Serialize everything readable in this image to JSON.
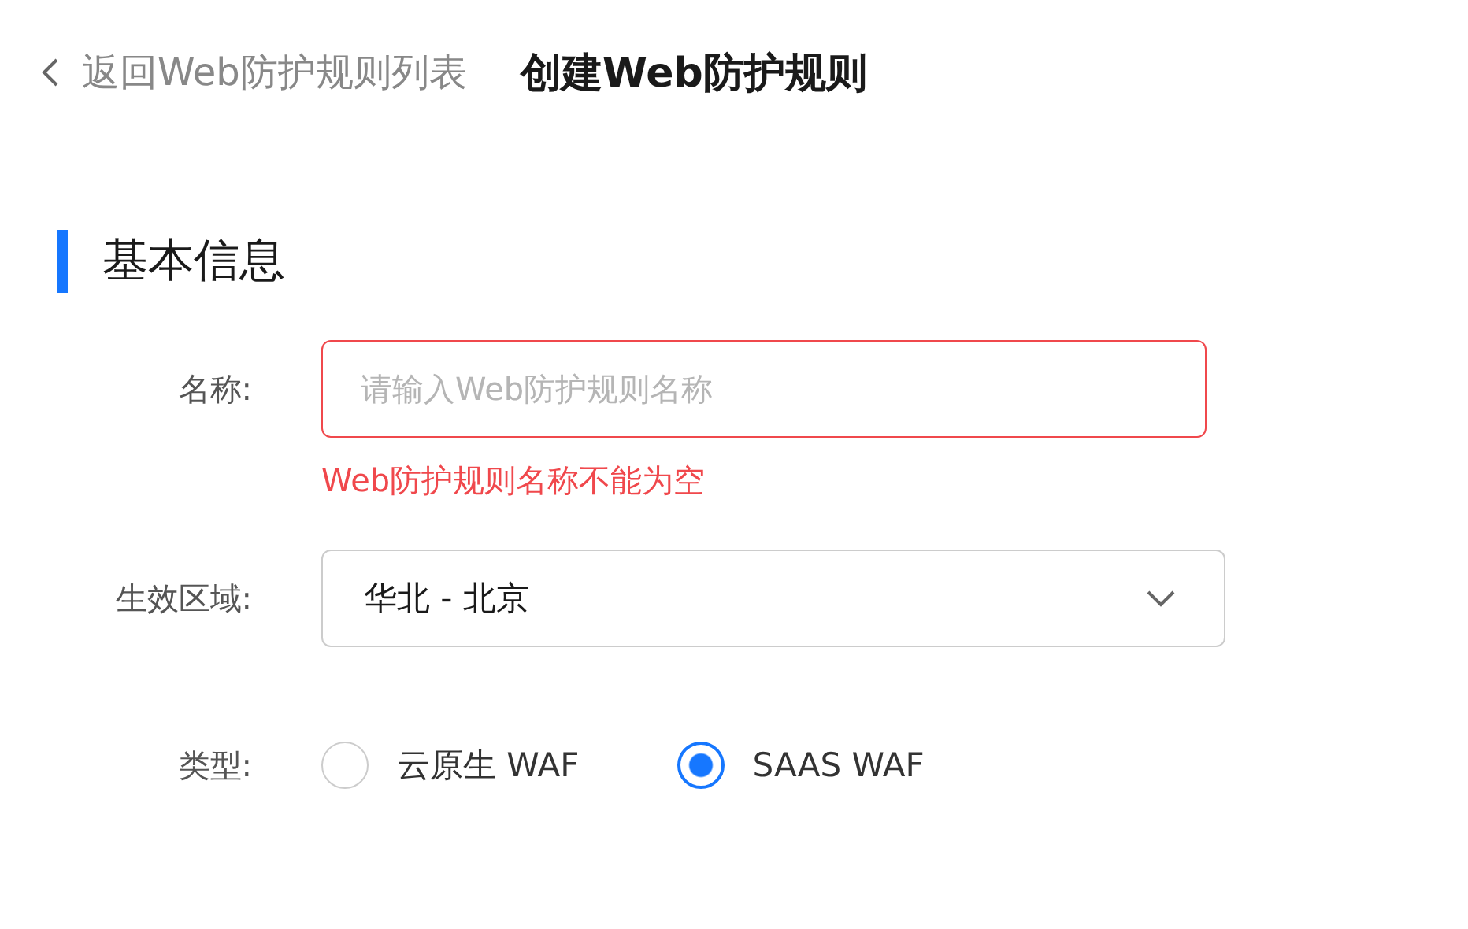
{
  "header": {
    "back_link": "返回Web防护规则列表",
    "title": "创建Web防护规则"
  },
  "section": {
    "title": "基本信息"
  },
  "form": {
    "name": {
      "label": "名称:",
      "placeholder": "请输入Web防护规则名称",
      "error": "Web防护规则名称不能为空"
    },
    "region": {
      "label": "生效区域:",
      "value": "华北 - 北京"
    },
    "type": {
      "label": "类型:",
      "options": [
        {
          "label": "云原生 WAF",
          "selected": false
        },
        {
          "label": "SAAS WAF",
          "selected": true
        }
      ]
    }
  }
}
